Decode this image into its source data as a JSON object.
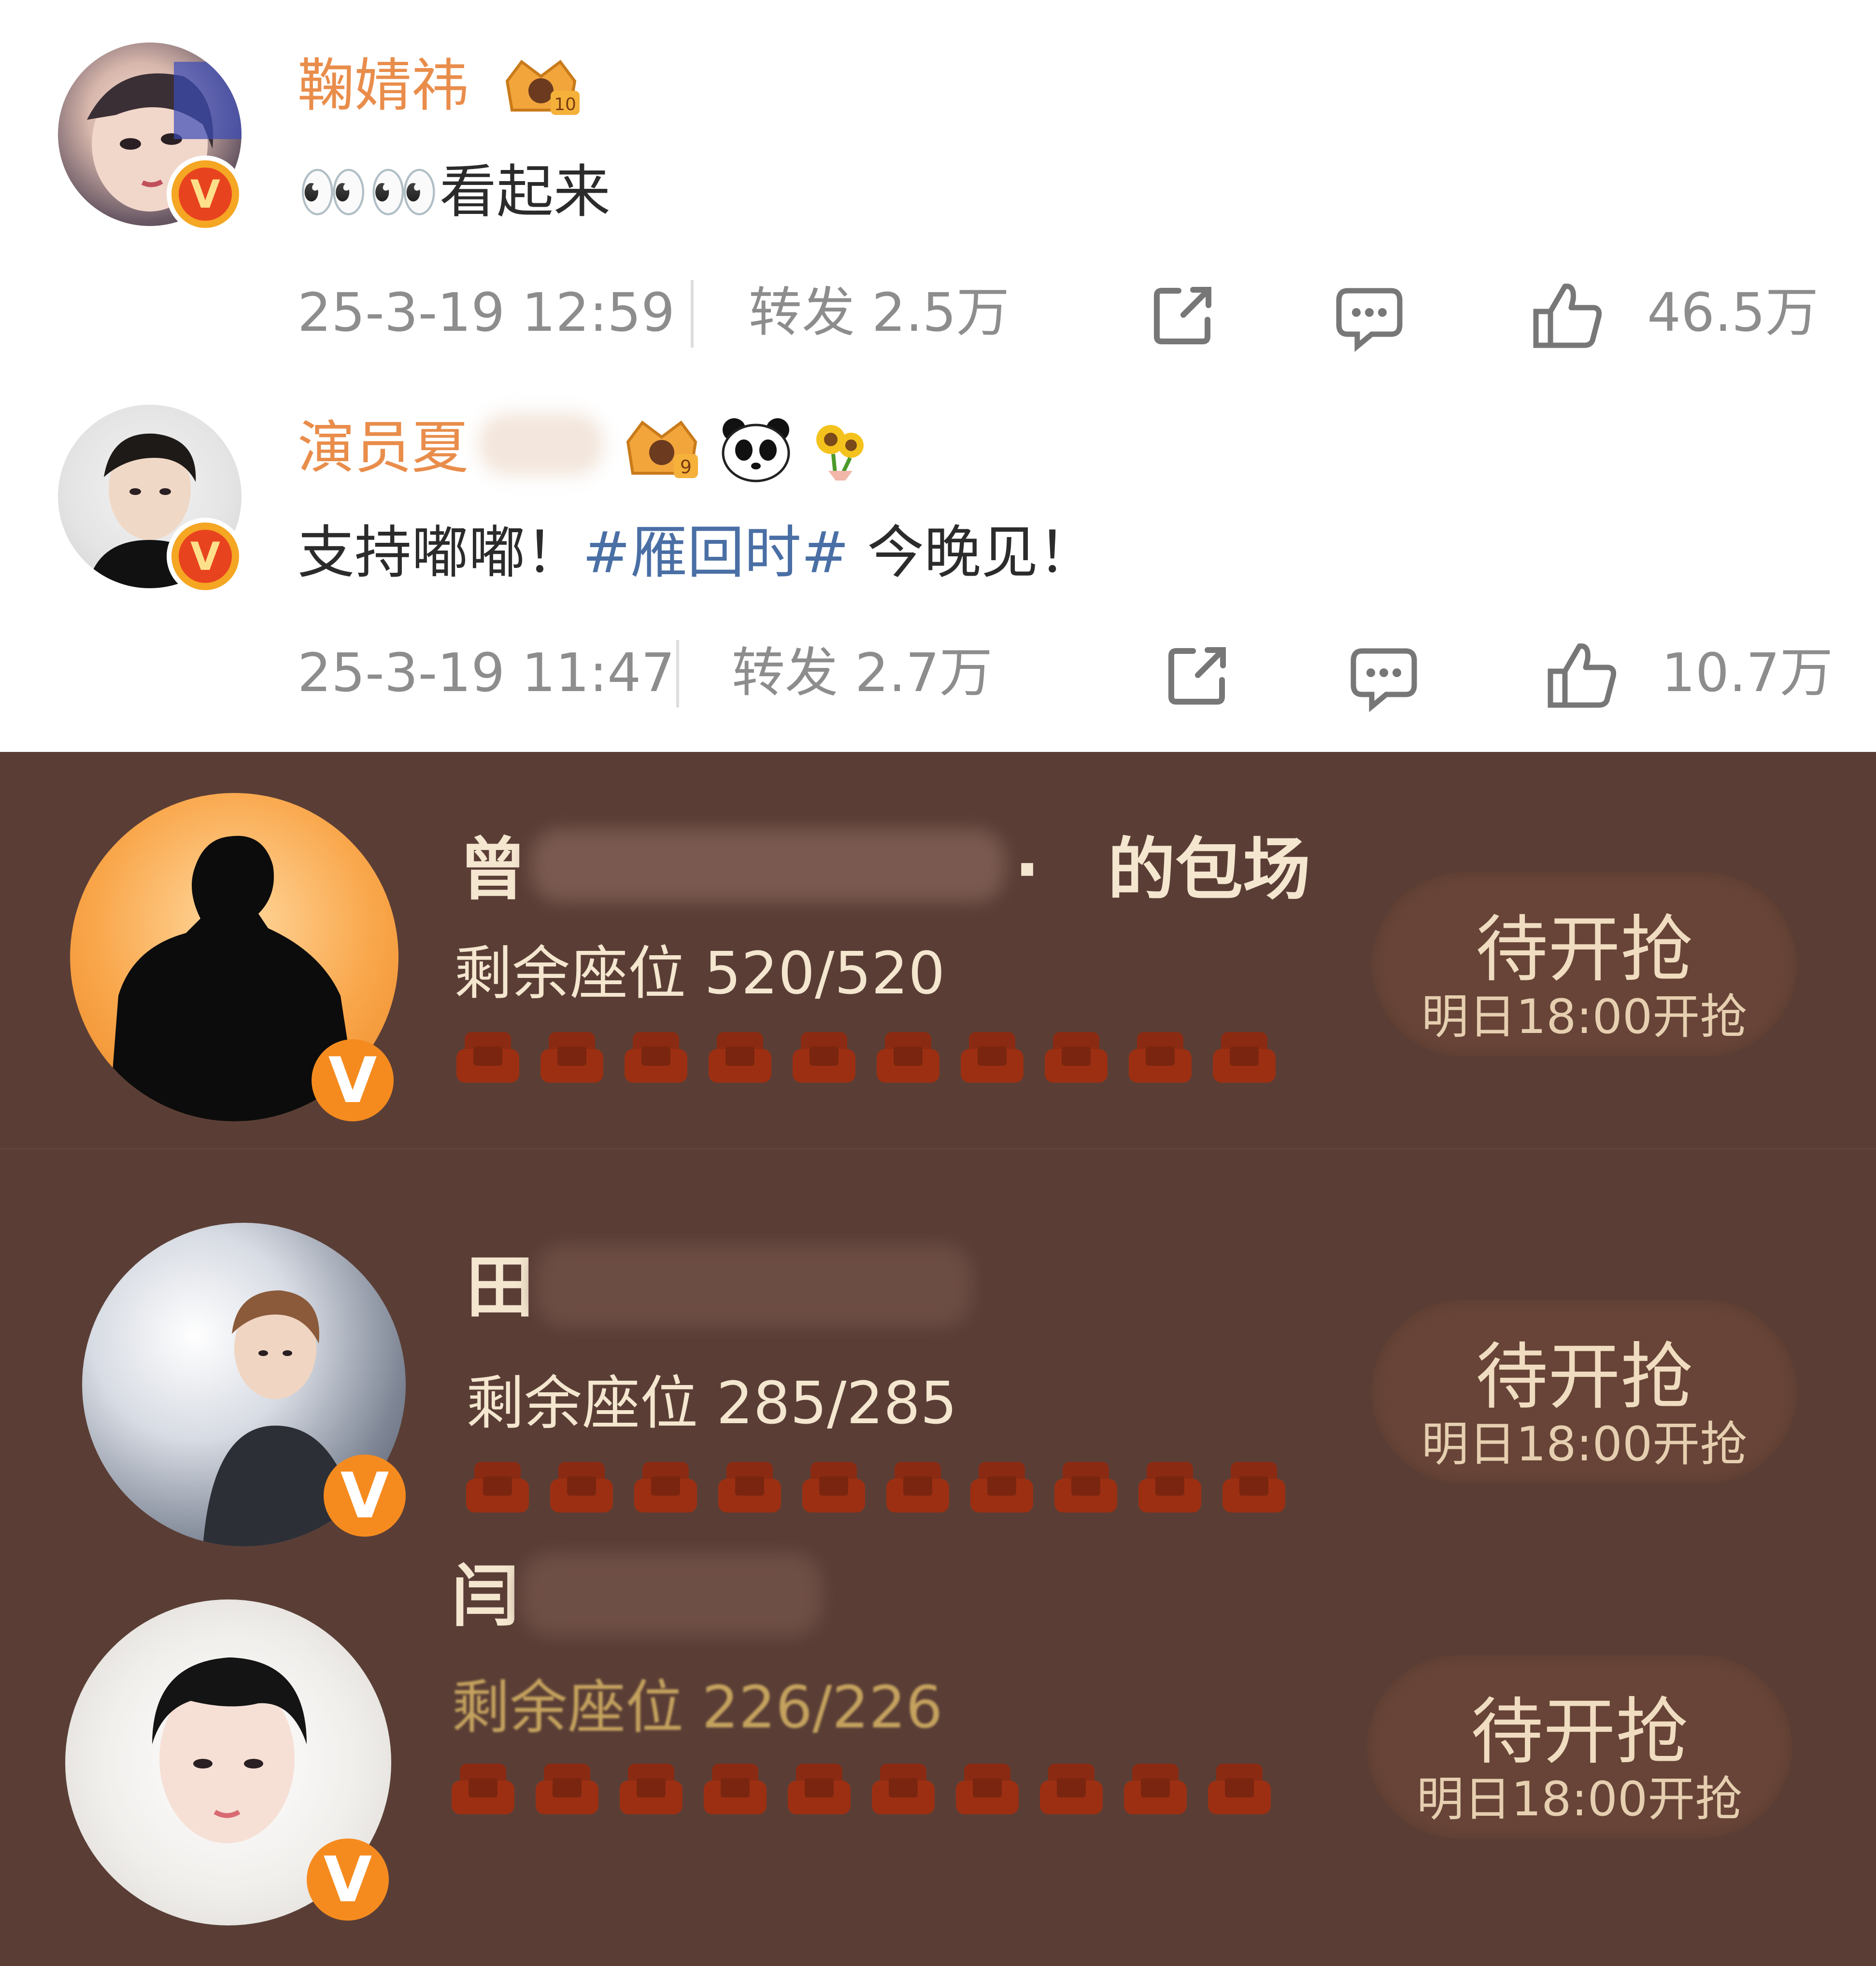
{
  "comments": [
    {
      "username": "鞠婧祎",
      "text": "👀👀看起来",
      "time": "25-3-19 12:59",
      "repost": "转发 2.5万",
      "likes": "46.5万"
    },
    {
      "username": "演员夏",
      "text_prefix": "支持嘟嘟！",
      "hashtag": "#雁回时#",
      "text_suffix": " 今晚见！",
      "time": "25-3-19 11:47",
      "repost": "转发 2.7万",
      "likes": "10.7万"
    }
  ],
  "sessions": [
    {
      "name_prefix": "曾",
      "name_suffix": "·　的包场",
      "seats": "剩余座位 520/520",
      "button_main": "待开抢",
      "button_sub": "明日18:00开抢"
    },
    {
      "name_prefix": "田",
      "name_suffix": "",
      "seats": "剩余座位 285/285",
      "button_main": "待开抢",
      "button_sub": "明日18:00开抢"
    },
    {
      "name_prefix": "闫",
      "name_suffix": "",
      "seats": "剩余座位 226/226",
      "button_main": "待开抢",
      "button_sub": "明日18:00开抢"
    }
  ],
  "icons": {
    "share": "share-icon",
    "comment": "comment-icon",
    "like": "like-icon",
    "verified": "verified-v-icon",
    "crown": "crown-badge-icon",
    "panda": "panda-icon",
    "sunflower": "sunflower-icon",
    "seat": "seat-icon"
  },
  "colors": {
    "username": "#e98d4b",
    "hashtag": "#4a6fa5",
    "meta": "#8d8d8d",
    "session_bg": "#5a3e36",
    "session_text": "#f4e6cf",
    "seat": "#8a2a12",
    "verified_orange": "#f58b1f"
  }
}
